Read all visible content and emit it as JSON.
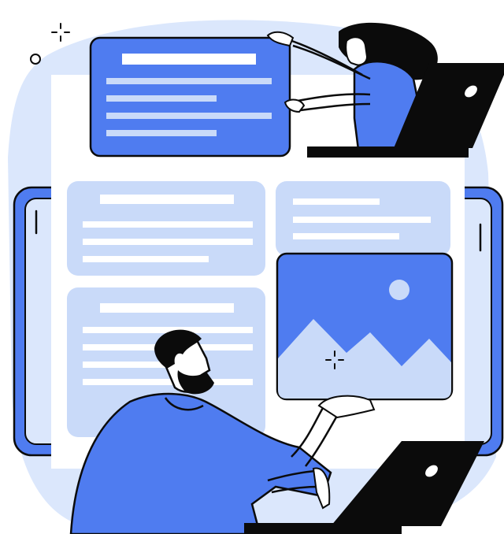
{
  "illustration": {
    "subject": "web-design-collaboration",
    "elements": [
      "text-card",
      "image-placeholder-card",
      "laptop",
      "person"
    ]
  },
  "colors": {
    "primary_blue": "#4f7cf0",
    "light_blue": "#c9daf9",
    "pale_blue": "#dbe7fc",
    "outline": "#0b0b0b",
    "white": "#ffffff",
    "skin": "#ffffff"
  },
  "icons": [
    "image-icon",
    "mountain-icon",
    "sun-icon",
    "sparkle-icon",
    "laptop-icon"
  ]
}
